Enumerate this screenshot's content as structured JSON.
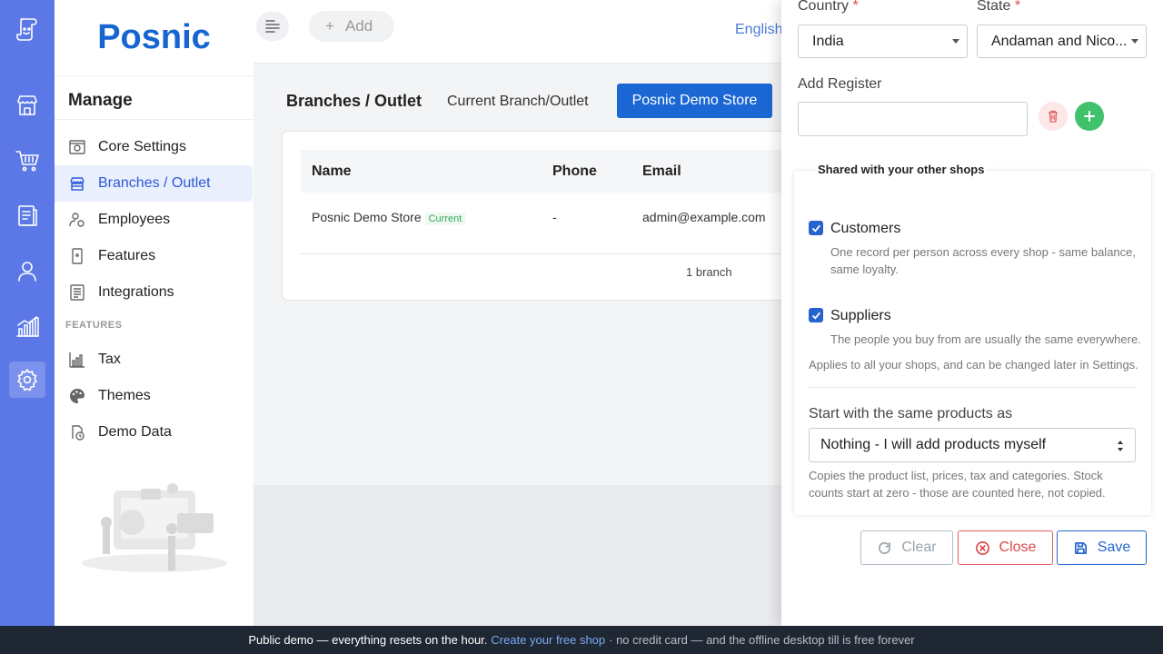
{
  "app": {
    "logo": "Posnic"
  },
  "menu": {
    "title": "Manage",
    "items": [
      {
        "label": "Core Settings",
        "icon": "settings-grid-icon"
      },
      {
        "label": "Branches / Outlet",
        "icon": "store-icon",
        "active": true
      },
      {
        "label": "Employees",
        "icon": "employees-icon"
      },
      {
        "label": "Features",
        "icon": "phone-icon"
      },
      {
        "label": "Integrations",
        "icon": "list-icon"
      }
    ],
    "section": "FEATURES",
    "feature_items": [
      {
        "label": "Tax",
        "icon": "chart-icon"
      },
      {
        "label": "Themes",
        "icon": "palette-icon"
      },
      {
        "label": "Demo Data",
        "icon": "clock-doc-icon"
      }
    ]
  },
  "header": {
    "add_label": "Add",
    "language": "English"
  },
  "page": {
    "title": "Branches / Outlet",
    "current_label": "Current Branch/Outlet",
    "current_store": "Posnic Demo Store"
  },
  "table": {
    "columns": [
      "Name",
      "Phone",
      "Email"
    ],
    "rows": [
      {
        "name": "Posnic Demo Store",
        "badge": "Current",
        "phone": "-",
        "email": "admin@example.com"
      }
    ],
    "footer": "1 branch"
  },
  "drawer": {
    "country_label": "Country",
    "country_value": "India",
    "state_label": "State",
    "state_value": "Andaman and Nico...",
    "required_mark": "*",
    "register_label": "Add Register",
    "register_value": "",
    "shared_title": "Shared with your other shops",
    "customers_label": "Customers",
    "customers_desc": "One record per person across every shop - same balance, same loyalty.",
    "suppliers_label": "Suppliers",
    "suppliers_desc": "The people you buy from are usually the same everywhere.",
    "applies_note": "Applies to all your shops, and can be changed later in Settings.",
    "products_label": "Start with the same products as",
    "products_value": "Nothing - I will add products myself",
    "products_note": "Copies the product list, prices, tax and categories. Stock counts start at zero - those are counted here, not copied.",
    "clear": "Clear",
    "close": "Close",
    "save": "Save"
  },
  "banner": {
    "text": "Public demo — everything resets on the hour.",
    "link": "Create your free shop",
    "tail": "· no credit card — and the offline desktop till is free forever"
  },
  "colors": {
    "rail": "#5b78e6",
    "primary": "#1b68d4",
    "brand": "#1765d1"
  }
}
